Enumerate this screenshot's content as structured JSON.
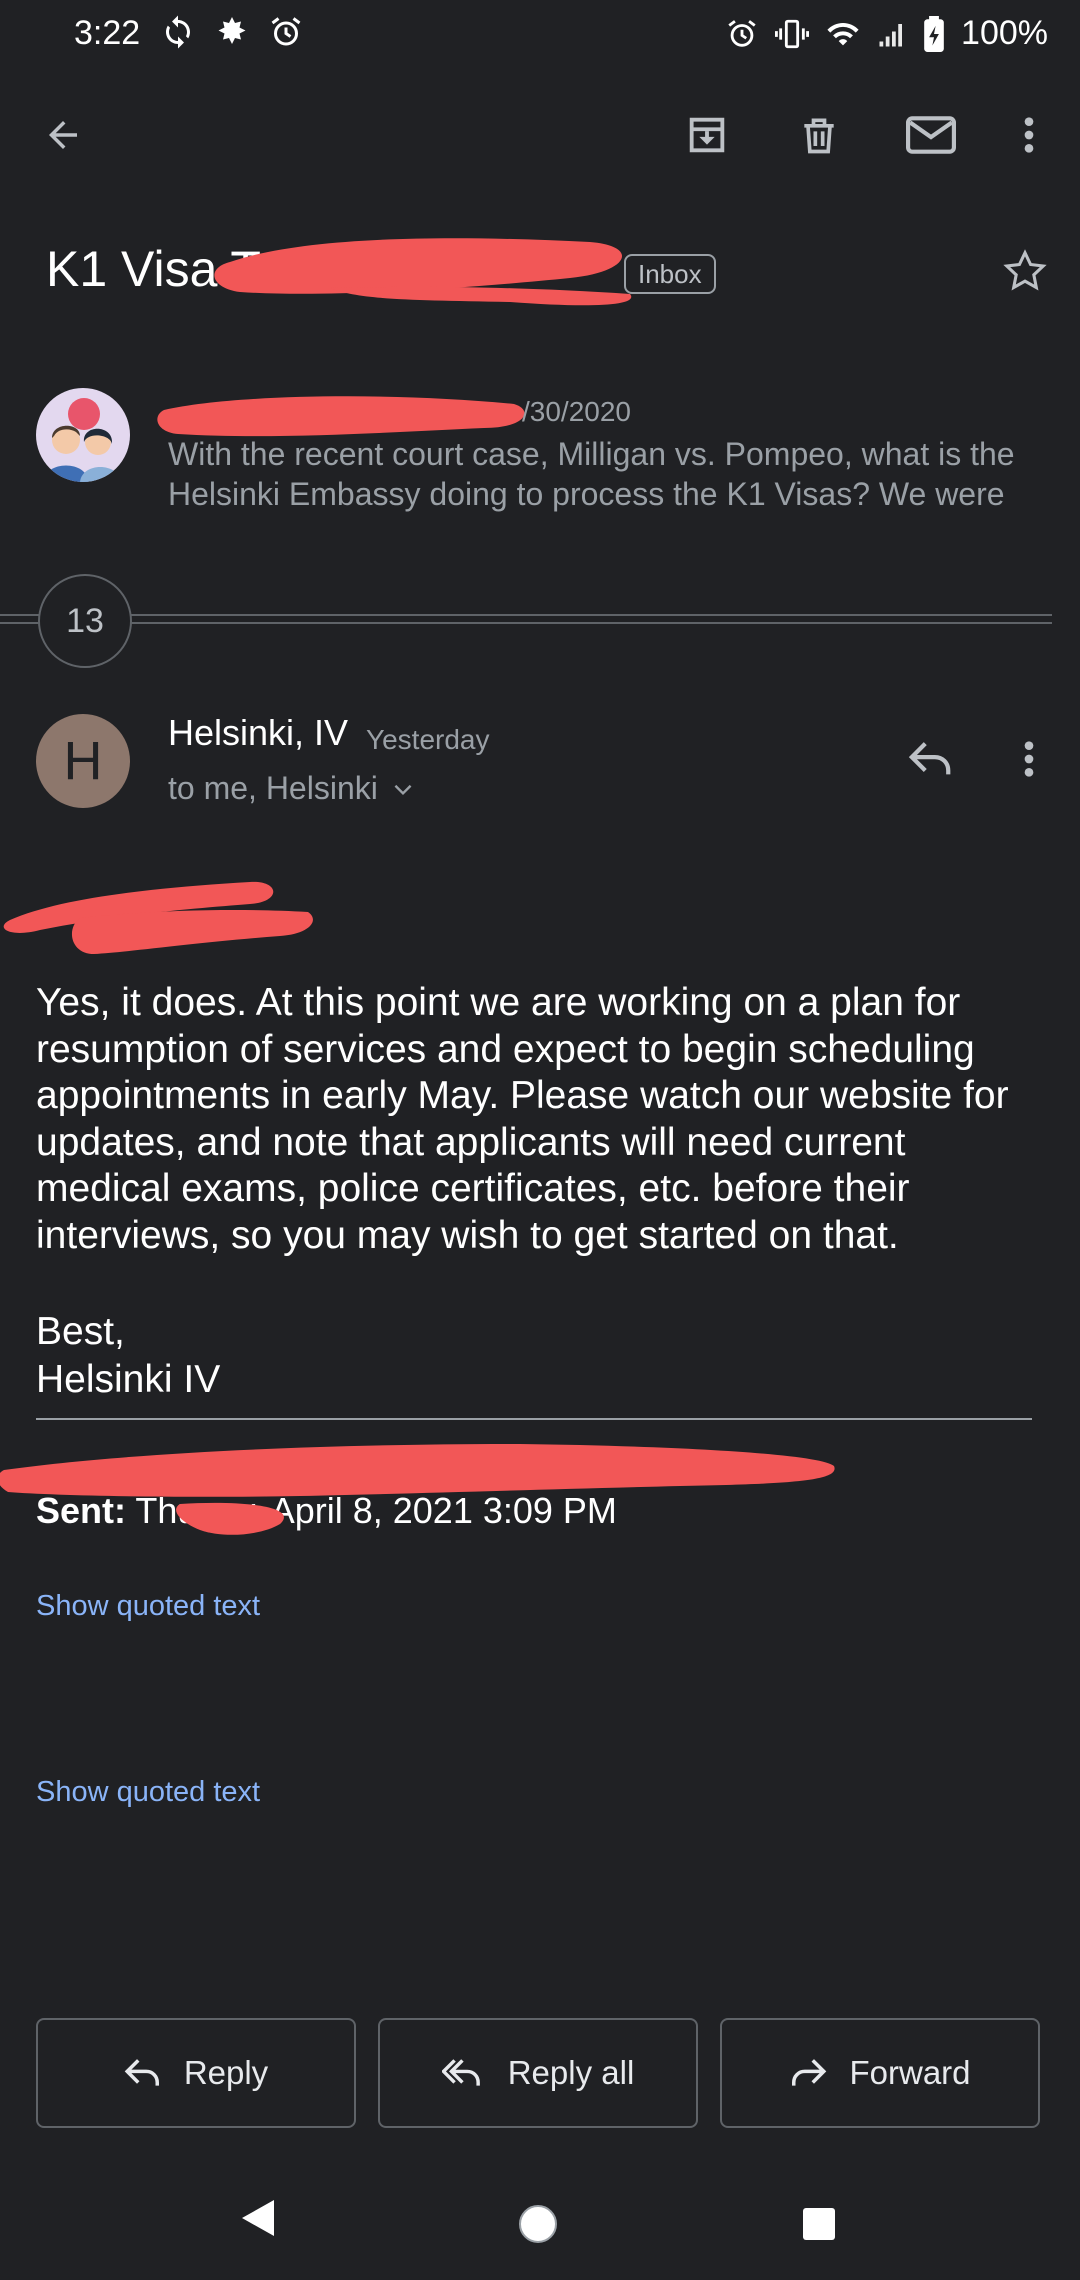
{
  "status_bar": {
    "time": "3:22",
    "battery": "100%"
  },
  "toolbar": {
    "back": "back-arrow-icon",
    "archive": "archive-icon",
    "delete": "trash-icon",
    "mark_unread": "mail-icon",
    "more": "more-vert-icon"
  },
  "subject": {
    "text": "K1 Visa T",
    "label": "Inbox"
  },
  "collapsed_message": {
    "date_fragment": "/30/2020",
    "preview": "With the recent court case, Milligan vs. Pompeo, what is the Helsinki Embassy doing to process the K1 Visas? We were"
  },
  "thread_count": "13",
  "message": {
    "avatar_letter": "H",
    "sender": "Helsinki, IV",
    "time": "Yesterday",
    "recipients": "to me, Helsinki",
    "body": "Yes, it does. At this point we are working on a plan for resumption of services and expect to begin scheduling appointments in early May. Please watch our website for updates, and note that applicants will need current medical exams, police certificates, etc. before their interviews, so you may wish to get started on that.",
    "sign_off": "Best,",
    "signature": "Helsinki IV",
    "sent_label": "Sent:",
    "sent_value": " Thurs   y, April 8, 2021 3:09 PM",
    "show_quoted_1": "Show quoted text",
    "show_quoted_2": "Show quoted text"
  },
  "actions": {
    "reply": "Reply",
    "reply_all": "Reply all",
    "forward": "Forward"
  },
  "colors": {
    "background": "#202124",
    "link": "#8ab4f8",
    "redaction": "#f25757",
    "avatar_h": "#8d776c"
  }
}
